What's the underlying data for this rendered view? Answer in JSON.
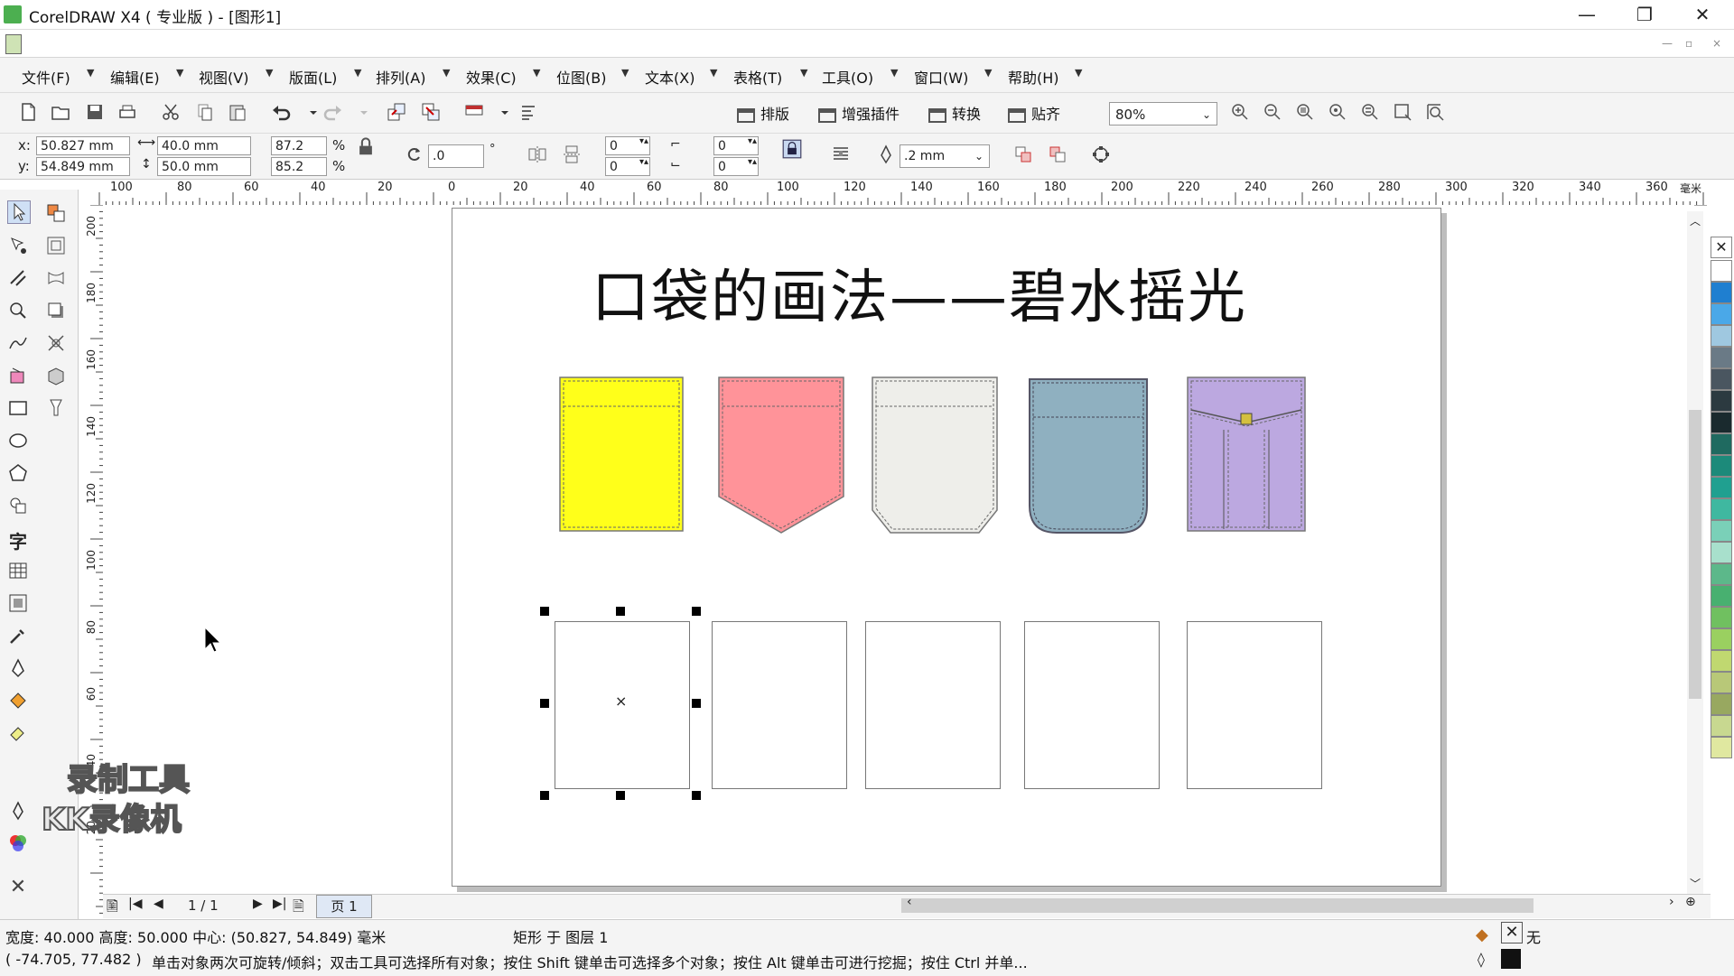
{
  "window": {
    "title": "CorelDRAW X4 ( 专业版 ) - [图形1]",
    "minimize": "—",
    "restore": "❐",
    "close": "✕"
  },
  "menu": [
    "文件(F)",
    "编辑(E)",
    "视图(V)",
    "版面(L)",
    "排列(A)",
    "效果(C)",
    "位图(B)",
    "文本(X)",
    "表格(T)",
    "工具(O)",
    "窗口(W)",
    "帮助(H)"
  ],
  "toolbar": {
    "layout_btn": "排版",
    "plugin_btn": "增强插件",
    "convert_btn": "转换",
    "snap_btn": "贴齐",
    "zoom": "80%"
  },
  "propbar": {
    "x_label": "x:",
    "y_label": "y:",
    "x": "50.827 mm",
    "y": "54.849 mm",
    "width": "40.0 mm",
    "height": "50.0 mm",
    "scale_x": "87.2",
    "scale_y": "85.2",
    "percent": "%",
    "rotation": ".0",
    "degree": "°",
    "corner_tl": "0",
    "corner_bl": "0",
    "corner_tr": "0",
    "corner_br": "0",
    "outline_width": ".2 mm"
  },
  "ruler": {
    "h_ticks": [
      "100",
      "80",
      "60",
      "40",
      "20",
      "0",
      "20",
      "40",
      "60",
      "80",
      "100",
      "120",
      "140",
      "160",
      "180",
      "200",
      "220",
      "240",
      "260",
      "280",
      "300",
      "320",
      "340",
      "360"
    ],
    "unit": "毫米",
    "v_ticks": [
      "200",
      "180",
      "160",
      "140",
      "120",
      "100",
      "80",
      "60",
      "40",
      "20"
    ]
  },
  "document": {
    "heading": "口袋的画法——碧水摇光",
    "pockets": [
      {
        "name": "yellow-pocket",
        "fill": "#ffff1a"
      },
      {
        "name": "pink-pocket",
        "fill": "#ff9399"
      },
      {
        "name": "white-pocket",
        "fill": "#eeeeea"
      },
      {
        "name": "blue-pocket",
        "fill": "#8fb0c0"
      },
      {
        "name": "purple-pocket",
        "fill": "#bca8e0"
      }
    ],
    "center_mark": "×"
  },
  "pagebar": {
    "page_count": "1 / 1",
    "page_tab": "页 1"
  },
  "status": {
    "dimensions": "宽度: 40.000  高度: 50.000  中心: (50.827, 54.849)  毫米",
    "object_info": "矩形 于 图层 1",
    "cursor": "( -74.705, 77.482 )",
    "hint": "单击对象两次可旋转/倾斜；双击工具可选择所有对象；按住 Shift 键单击可选择多个对象；按住 Alt 键单击可进行挖掘；按住 Ctrl 并单...",
    "fill_none": "无"
  },
  "watermark": {
    "line1": "录制工具",
    "line2": "KK录像机"
  },
  "palette": [
    "#ffffff",
    "#1f7fd0",
    "#4aa8e8",
    "#9fc8e0",
    "#6a7a86",
    "#4a5660",
    "#2c3a40",
    "#1a2a2e",
    "#1f6a60",
    "#1c8a7a",
    "#20a090",
    "#3fb8a0",
    "#7ad0b8",
    "#a8e0cc",
    "#5cb88a",
    "#48b070",
    "#70c060",
    "#9ad060",
    "#c0d870",
    "#b8c878",
    "#98a860",
    "#c8d890",
    "#e0e8a0"
  ]
}
